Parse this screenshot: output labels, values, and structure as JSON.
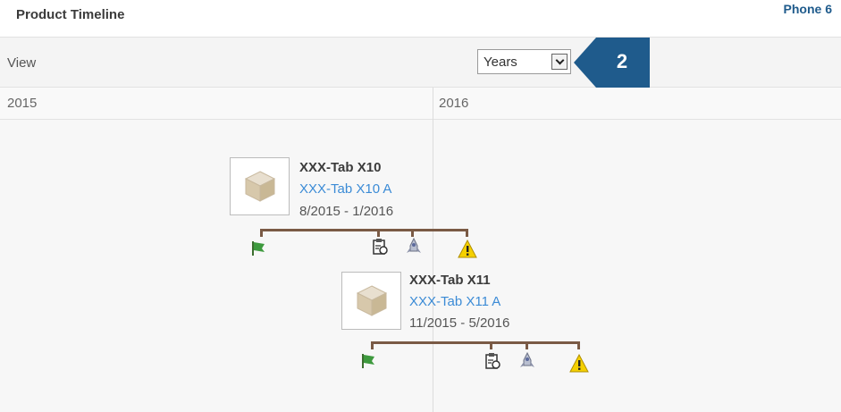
{
  "header": {
    "title": "Product Timeline",
    "phone_label": "Phone 6"
  },
  "view_bar": {
    "label": "View",
    "select_value": "Years",
    "callout_number": "2"
  },
  "years": [
    "2015",
    "2016"
  ],
  "products": [
    {
      "name": "XXX-Tab X10",
      "link": "XXX-Tab X10 A",
      "dates": "8/2015 - 1/2016",
      "icons": [
        "flag-icon",
        "clipboard-icon",
        "rocket-icon",
        "warning-icon"
      ]
    },
    {
      "name": "XXX-Tab X11",
      "link": "XXX-Tab X11 A",
      "dates": "11/2015 - 5/2016",
      "icons": [
        "flag-icon",
        "clipboard-icon",
        "rocket-icon",
        "warning-icon"
      ]
    }
  ],
  "colors": {
    "callout": "#1f5b8c",
    "link": "#3b8bd6",
    "timeline_bar": "#7a5a45",
    "flag": "#3e9a3e",
    "warning": "#f5d000"
  }
}
